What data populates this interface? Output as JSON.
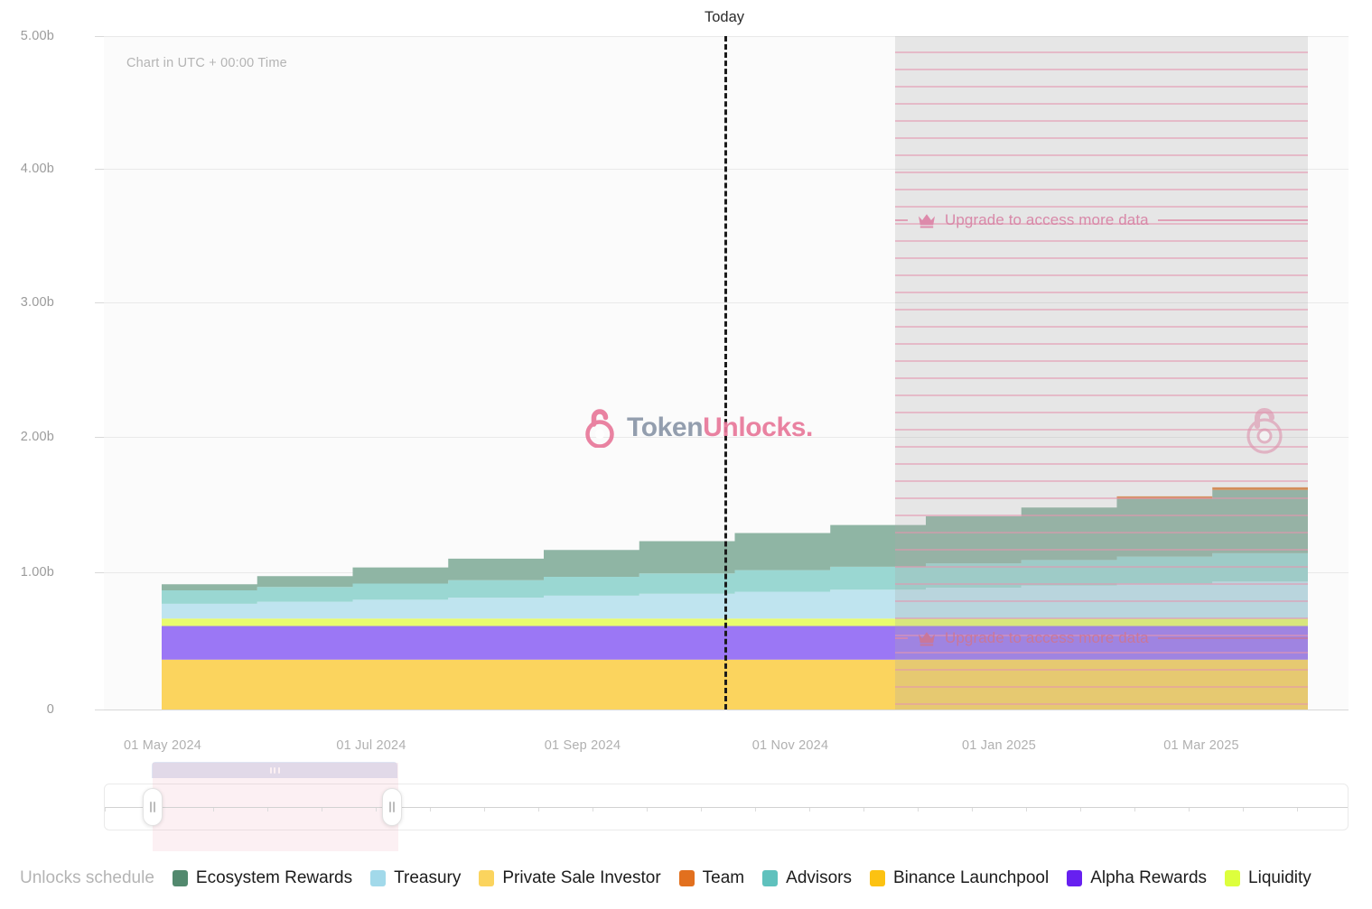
{
  "header": {
    "today_label": "Today",
    "chart_note": "Chart in UTC + 00:00 Time"
  },
  "watermark": {
    "token": "Token",
    "unlocks": "Unlocks",
    "dot": ".",
    "lock_icon": "open-padlock-icon"
  },
  "upgrade": {
    "label": "Upgrade to access more data",
    "icon": "crown-icon",
    "color": "#d888a8"
  },
  "legend": {
    "title": "Unlocks schedule",
    "items": [
      {
        "label": "Ecosystem Rewards",
        "color": "#52896e"
      },
      {
        "label": "Treasury",
        "color": "#a2d9ea"
      },
      {
        "label": "Private Sale Investor",
        "color": "#fbd45e"
      },
      {
        "label": "Team",
        "color": "#e2701e"
      },
      {
        "label": "Advisors",
        "color": "#5fc1bd"
      },
      {
        "label": "Binance Launchpool",
        "color": "#fcc212"
      },
      {
        "label": "Alpha Rewards",
        "color": "#6720f0"
      },
      {
        "label": "Liquidity",
        "color": "#ddff3d"
      }
    ]
  },
  "slider": {
    "name": "date-range-slider",
    "left_handle": "range-handle-left",
    "right_handle": "range-handle-right",
    "drag_bar": "range-drag-bar"
  },
  "chart_data": {
    "type": "area",
    "title": "",
    "subtitle": "Chart in UTC + 00:00 Time",
    "xlabel": "",
    "ylabel": "",
    "stacked": true,
    "step": "post",
    "grid": true,
    "legend_position": "bottom",
    "ylim": [
      0,
      5000000000
    ],
    "ytick_labels": [
      "0",
      "1.00b",
      "2.00b",
      "3.00b",
      "4.00b",
      "5.00b"
    ],
    "ytick_values": [
      0,
      1000000000,
      2000000000,
      3000000000,
      4000000000,
      5000000000
    ],
    "xtick_labels": [
      "01 May 2024",
      "01 Jul 2024",
      "01 Sep 2024",
      "01 Nov 2024",
      "01 Jan 2025",
      "01 Mar 2025"
    ],
    "x": [
      "2024-04-15",
      "2024-05-15",
      "2024-06-15",
      "2024-07-15",
      "2024-08-15",
      "2024-09-15",
      "2024-10-15",
      "2024-11-15",
      "2024-12-15",
      "2025-01-15",
      "2025-02-15",
      "2025-03-15",
      "2025-04-01"
    ],
    "annotations": [
      {
        "type": "vline",
        "label": "Today",
        "x": "2024-10-13",
        "style": "dashed",
        "color": "#1b1b1b"
      },
      {
        "type": "region",
        "label": "Upgrade to access more data",
        "x_start": "2024-12-01",
        "x_end": "2025-04-01",
        "locked": true
      }
    ],
    "series": [
      {
        "name": "Private Sale Investor",
        "color": "#fbd45e",
        "values": [
          370000000,
          370000000,
          370000000,
          370000000,
          370000000,
          370000000,
          370000000,
          370000000,
          370000000,
          370000000,
          370000000,
          370000000,
          370000000
        ]
      },
      {
        "name": "Alpha Rewards",
        "color": "#9b77f5",
        "values": [
          250000000,
          250000000,
          250000000,
          250000000,
          250000000,
          250000000,
          250000000,
          250000000,
          250000000,
          250000000,
          250000000,
          250000000,
          250000000
        ]
      },
      {
        "name": "Liquidity",
        "color": "#e9fb6e",
        "values": [
          55000000,
          55000000,
          55000000,
          55000000,
          55000000,
          55000000,
          55000000,
          55000000,
          55000000,
          55000000,
          55000000,
          55000000,
          55000000
        ]
      },
      {
        "name": "Treasury",
        "color": "#bfe4ef",
        "values": [
          110000000,
          125000000,
          140000000,
          155000000,
          170000000,
          185000000,
          200000000,
          215000000,
          230000000,
          245000000,
          260000000,
          275000000,
          275000000
        ]
      },
      {
        "name": "Advisors",
        "color": "#9ad7d2",
        "values": [
          100000000,
          110000000,
          120000000,
          130000000,
          140000000,
          150000000,
          160000000,
          170000000,
          180000000,
          190000000,
          200000000,
          210000000,
          210000000
        ]
      },
      {
        "name": "Ecosystem Rewards",
        "color": "#8fb5a4",
        "values": [
          45000000,
          80000000,
          120000000,
          160000000,
          200000000,
          240000000,
          275000000,
          310000000,
          350000000,
          390000000,
          430000000,
          470000000,
          470000000
        ]
      },
      {
        "name": "Team",
        "color": "#e2843e",
        "values": [
          0,
          0,
          0,
          0,
          0,
          0,
          0,
          0,
          0,
          0,
          18000000,
          20000000,
          20000000
        ]
      }
    ],
    "totals": [
      930000000,
      990000000,
      1055000000,
      1120000000,
      1185000000,
      1250000000,
      1310000000,
      1370000000,
      1435000000,
      1500000000,
      1583000000,
      1650000000,
      1650000000
    ]
  }
}
